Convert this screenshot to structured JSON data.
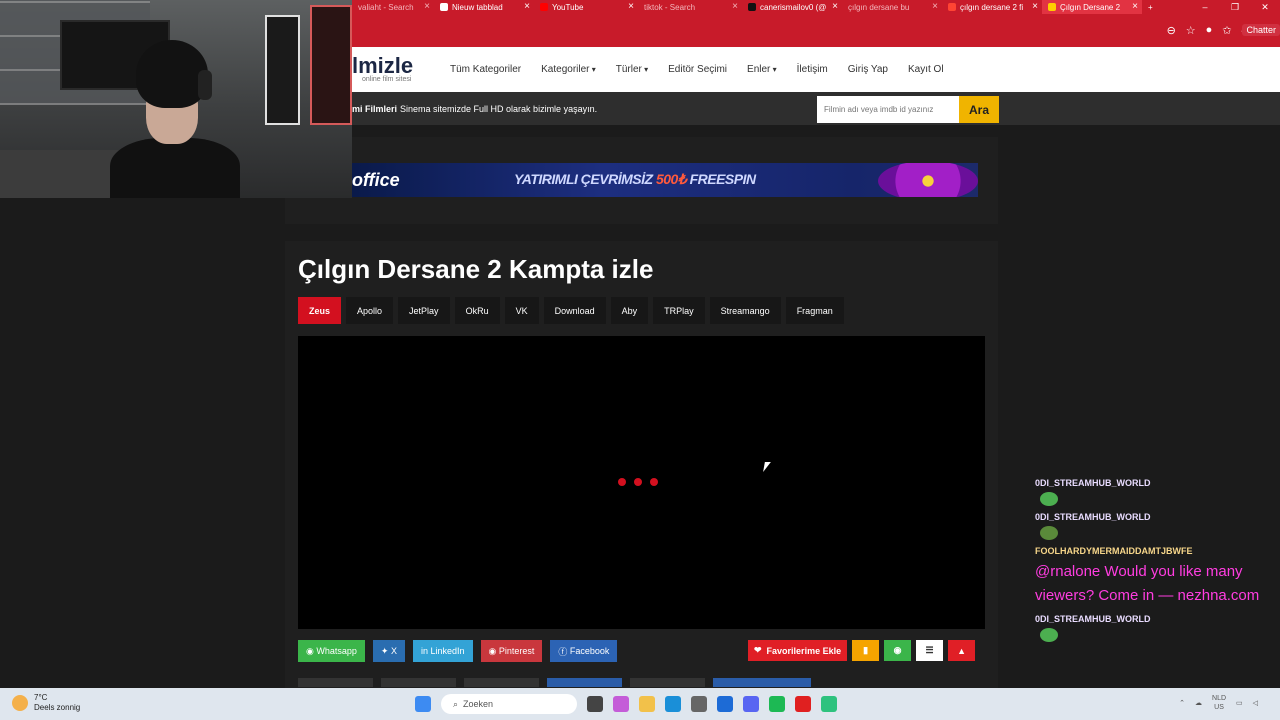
{
  "browser": {
    "tabs": [
      {
        "label": "valiaht - Search",
        "dim": true
      },
      {
        "label": "Nieuw tabblad",
        "dim": false
      },
      {
        "label": "YouTube",
        "dim": false
      },
      {
        "label": "tiktok - Search",
        "dim": true
      },
      {
        "label": "canerismailov0 (@",
        "dim": false
      },
      {
        "label": "çılgın dersane bu",
        "dim": true
      },
      {
        "label": "çılgın dersane 2 fi",
        "dim": false
      },
      {
        "label": "Çılgın Dersane 2",
        "dim": false,
        "active": true
      }
    ],
    "extension_label": "Chatter",
    "accent": "#c81b2a"
  },
  "site": {
    "logo_text": "lmizle",
    "logo_sub": "online film sitesi",
    "menu": [
      {
        "label": "Tüm Kategoriler",
        "caret": false
      },
      {
        "label": "Kategoriler",
        "caret": true
      },
      {
        "label": "Türler",
        "caret": true
      },
      {
        "label": "Editör Seçimi",
        "caret": false
      },
      {
        "label": "Enler",
        "caret": true
      },
      {
        "label": "İletişim",
        "caret": false
      },
      {
        "label": "Giriş Yap",
        "caret": false
      },
      {
        "label": "Kayıt Ol",
        "caret": false
      }
    ],
    "subbar_bold": "mi Filmleri",
    "subbar_text": "Sinema sitemizde Full HD olarak bizimle yaşayın.",
    "search_placeholder": "Filmin adı veya imdb id yazınız",
    "search_button": "Ara",
    "brand_yellow": "#f0b400"
  },
  "banner": {
    "brand": "office",
    "promo_prefix": "YATIRIMLI ÇEVRİMSİZ",
    "promo_amount": "500₺",
    "promo_suffix": "FREESPIN"
  },
  "movie": {
    "title": "Çılgın Dersane 2 Kampta izle",
    "sources": [
      "Zeus",
      "Apollo",
      "JetPlay",
      "OkRu",
      "VK",
      "Download",
      "Aby",
      "TRPlay",
      "Streamango",
      "Fragman"
    ],
    "active_source": "Zeus",
    "accent": "#d3101f"
  },
  "share": [
    {
      "label": "Whatsapp",
      "icon": "whatsapp-icon",
      "color": "#3bb54a"
    },
    {
      "label": "X",
      "icon": "x-icon",
      "color": "#2a6db0"
    },
    {
      "label": "LinkedIn",
      "icon": "linkedin-icon",
      "color": "#33a3d6"
    },
    {
      "label": "Pinterest",
      "icon": "pinterest-icon",
      "color": "#c9373d"
    },
    {
      "label": "Facebook",
      "icon": "facebook-icon",
      "color": "#2c63b4"
    }
  ],
  "actions": {
    "favorite_label": "Favorilerime Ekle",
    "favorite_color": "#e01f26",
    "bookmark_color": "#f5a400",
    "watched_color": "#3bb54a",
    "list_color": "#ffffff",
    "report_color": "#e01f26"
  },
  "chat": [
    {
      "name": "0DI_STREAMHUB_WORLD",
      "emote": "frog-emote",
      "gold": false
    },
    {
      "name": "0DI_STREAMHUB_WORLD",
      "emote": "turtle-emote",
      "gold": false
    },
    {
      "name": "FOOLHARDYMERMAIDDAMTJBWFE",
      "message": "@rnalone Would you like many viewers? Come in — nezhna.com",
      "gold": true
    },
    {
      "name": "0DI_STREAMHUB_WORLD",
      "emote": "frog-emote",
      "gold": false
    }
  ],
  "taskbar": {
    "temperature": "7°C",
    "weather": "Deels zonnig",
    "search_label": "Zoeken",
    "lang": "NLD",
    "lang_sub": "US"
  }
}
